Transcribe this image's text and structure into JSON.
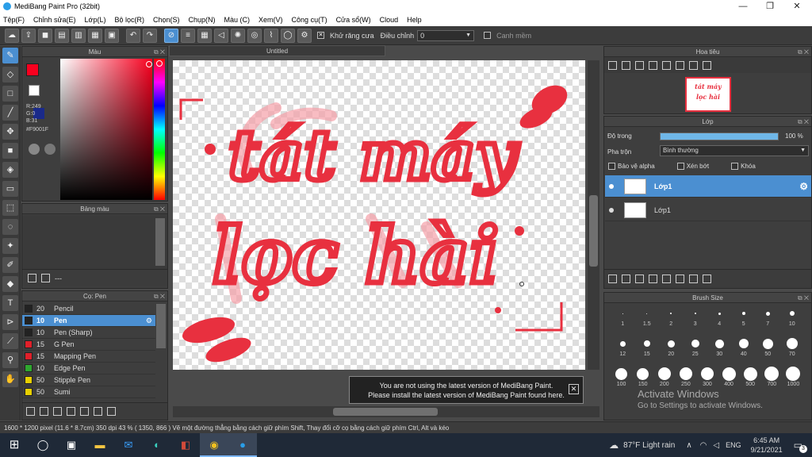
{
  "window": {
    "title": "MediBang Paint Pro (32bit)",
    "min": "—",
    "max": "❐",
    "close": "✕"
  },
  "menu": [
    "Tệp(F)",
    "Chỉnh sửa(E)",
    "Lớp(L)",
    "Bộ lọc(R)",
    "Chọn(S)",
    "Chụp(N)",
    "Màu (C)",
    "Xem(V)",
    "Công cụ(T)",
    "Cửa sổ(W)",
    "Cloud",
    "Help"
  ],
  "toolbar": {
    "antialias_label": "Khử răng cưa",
    "adjust_label": "Điều chỉnh",
    "adjust_value": "0",
    "snap_label": "Canh mềm"
  },
  "color_panel": {
    "title": "Màu",
    "r": "R:249",
    "g": "G:0",
    "b": "B:31",
    "hex": "#F9001F",
    "primary": "#f9001f",
    "secondary": "#1a2a8a"
  },
  "palette_panel": {
    "title": "Bảng màu",
    "footer_text": "---"
  },
  "brush_panel": {
    "title": "Cọ: Pen",
    "items": [
      {
        "size": "20",
        "name": "Pencil",
        "color": "#222222"
      },
      {
        "size": "10",
        "name": "Pen",
        "color": "#222222"
      },
      {
        "size": "10",
        "name": "Pen (Sharp)",
        "color": "#222222"
      },
      {
        "size": "15",
        "name": "G Pen",
        "color": "#e0202a"
      },
      {
        "size": "15",
        "name": "Mapping Pen",
        "color": "#e0202a"
      },
      {
        "size": "10",
        "name": "Edge Pen",
        "color": "#2fa82f"
      },
      {
        "size": "50",
        "name": "Stipple Pen",
        "color": "#e8d000"
      },
      {
        "size": "50",
        "name": "Sumi",
        "color": "#e8d000"
      }
    ]
  },
  "document": {
    "tab": "Untitled",
    "art_text_line1": "tát máy",
    "art_text_line2": "lọc hài",
    "ink": "#e8303f"
  },
  "notice": {
    "line1": "You are not using the latest version of MediBang Paint.",
    "line2": "Please install the latest version of MediBang Paint found here."
  },
  "navigator": {
    "title": "Hoa tiêu"
  },
  "layer_panel": {
    "title": "Lớp",
    "opacity_label": "Độ trong",
    "opacity_value": "100 %",
    "opacity": 1.0,
    "blend_label": "Pha trộn",
    "blend_value": "Bình thường",
    "protect_alpha": "Bảo vệ alpha",
    "clipping": "Xén bớt",
    "lock": "Khóa",
    "layers": [
      {
        "name": "Lớp1",
        "selected": true
      },
      {
        "name": "Lớp1",
        "selected": false
      }
    ]
  },
  "brush_size_panel": {
    "title": "Brush Size",
    "row1": [
      "1",
      "1.5",
      "2",
      "3",
      "4",
      "5",
      "7",
      "10"
    ],
    "row2": [
      "12",
      "15",
      "20",
      "25",
      "30",
      "40",
      "50",
      "70"
    ],
    "row3": [
      "100",
      "150",
      "200",
      "250",
      "300",
      "400",
      "500",
      "700",
      "1000"
    ]
  },
  "statusbar": {
    "text": "1600 * 1200 pixel  (11.6 * 8.7cm)  350 dpi  43 %  ( 1350, 866 )  Vẽ một đường thẳng bằng cách giữ phím Shift, Thay đổi cỡ cọ bằng cách giữ phím Ctrl, Alt và kéo"
  },
  "watermark": {
    "line1": "Activate Windows",
    "line2": "Go to Settings to activate Windows."
  },
  "taskbar": {
    "weather": "87°F  Light rain",
    "lang": "ENG",
    "time": "6:45 AM",
    "date": "9/21/2021",
    "notif_count": "3"
  }
}
